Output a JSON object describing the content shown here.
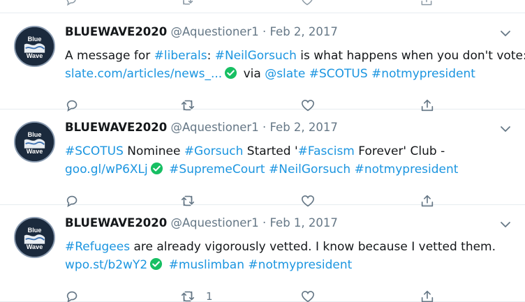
{
  "tweets": [
    {
      "name": "BLUEWAVE2020",
      "handle": "@Aquestioner1",
      "sep": "·",
      "date": "Feb 2, 2017",
      "avatar_text": {
        "top": "Blue",
        "bottom": "Wave"
      },
      "line1": [
        {
          "text": "A message for ",
          "link": false
        },
        {
          "text": "#liberals",
          "link": true
        },
        {
          "text": ": ",
          "link": false
        },
        {
          "text": "#NeilGorsuch",
          "link": true
        },
        {
          "text": " is what happens when you don't vote:",
          "link": false
        }
      ],
      "line2_before_check": "slate.com/articles/news_...",
      "line2_after": [
        {
          "text": " via ",
          "link": false
        },
        {
          "text": "@slate",
          "link": true
        },
        {
          "text": " ",
          "link": false
        },
        {
          "text": "#SCOTUS",
          "link": true
        },
        {
          "text": " ",
          "link": false
        },
        {
          "text": "#notmypresident",
          "link": true
        }
      ],
      "retweet_count": ""
    },
    {
      "name": "BLUEWAVE2020",
      "handle": "@Aquestioner1",
      "sep": "·",
      "date": "Feb 2, 2017",
      "avatar_text": {
        "top": "Blue",
        "bottom": "Wave"
      },
      "line1": [
        {
          "text": "#SCOTUS",
          "link": true
        },
        {
          "text": " Nominee ",
          "link": false
        },
        {
          "text": "#Gorsuch",
          "link": true
        },
        {
          "text": " Started '",
          "link": false
        },
        {
          "text": "#Fascism",
          "link": true
        },
        {
          "text": " Forever' Club -",
          "link": false
        }
      ],
      "line2_before_check": "goo.gl/wP6XLj",
      "line2_after": [
        {
          "text": " ",
          "link": false
        },
        {
          "text": "#SupremeCourt",
          "link": true
        },
        {
          "text": " ",
          "link": false
        },
        {
          "text": "#NeilGorsuch",
          "link": true
        },
        {
          "text": " ",
          "link": false
        },
        {
          "text": "#notmypresident",
          "link": true
        }
      ],
      "retweet_count": ""
    },
    {
      "name": "BLUEWAVE2020",
      "handle": "@Aquestioner1",
      "sep": "·",
      "date": "Feb 1, 2017",
      "avatar_text": {
        "top": "Blue",
        "bottom": "Wave"
      },
      "line1": [
        {
          "text": "#Refugees",
          "link": true
        },
        {
          "text": " are already vigorously vetted. I know because I vetted them.",
          "link": false
        }
      ],
      "line2_before_check": "wpo.st/b2wY2",
      "line2_after": [
        {
          "text": " ",
          "link": false
        },
        {
          "text": "#muslimban",
          "link": true
        },
        {
          "text": " ",
          "link": false
        },
        {
          "text": "#notmypresident",
          "link": true
        }
      ],
      "retweet_count": "1"
    }
  ],
  "icons": {
    "reply": "reply-icon",
    "retweet": "retweet-icon",
    "like": "like-icon",
    "share": "share-icon",
    "caret": "chevron-down-icon",
    "verified_link": "check-circle-icon"
  },
  "colors": {
    "link": "#1b95e0",
    "text": "#14171a",
    "muted": "#657786",
    "check": "#17bf63",
    "divider": "#e6ecf0"
  }
}
